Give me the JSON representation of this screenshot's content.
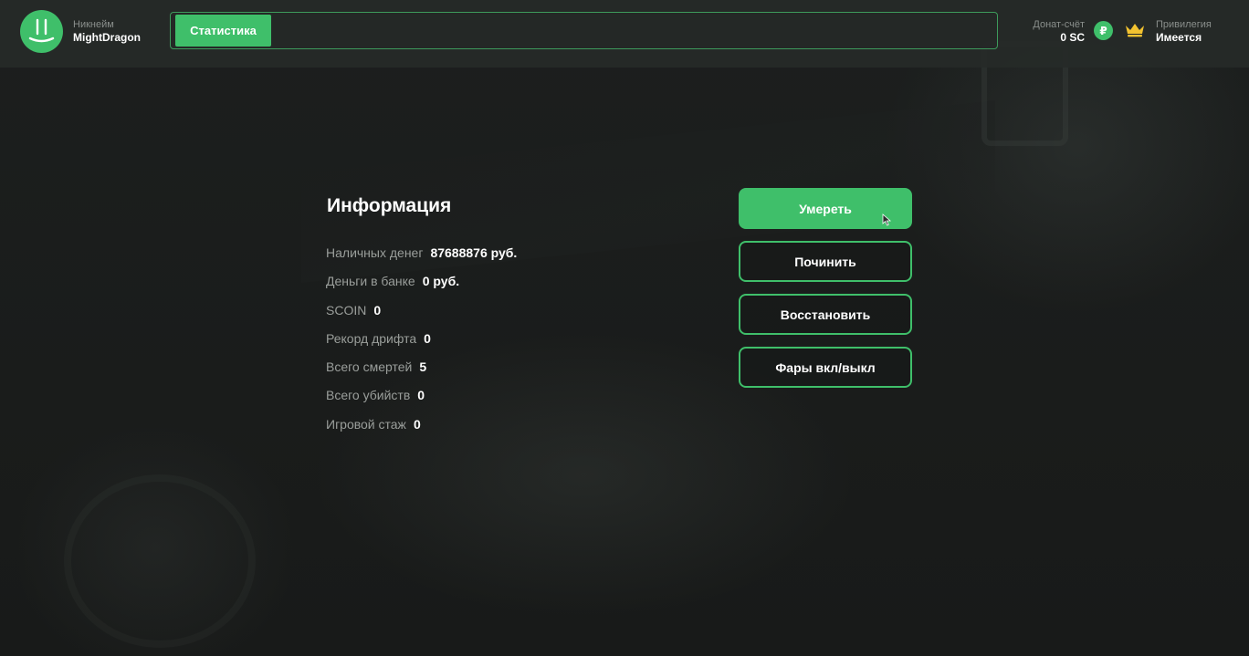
{
  "header": {
    "nickname_caption": "Никнейм",
    "nickname": "MightDragon",
    "tabs": [
      {
        "label": "Статистика",
        "active": true
      }
    ],
    "donate_caption": "Донат-счёт",
    "donate_value": "0 SC",
    "coin_symbol": "₽",
    "privilege_caption": "Привилегия",
    "privilege_value": "Имеется"
  },
  "info": {
    "title": "Информация",
    "rows": [
      {
        "label": "Наличных денег",
        "value": "87688876 руб."
      },
      {
        "label": "Деньги в банке",
        "value": "0 руб."
      },
      {
        "label": "SCOIN",
        "value": "0"
      },
      {
        "label": "Рекорд дрифта",
        "value": "0"
      },
      {
        "label": "Всего смертей",
        "value": "5"
      },
      {
        "label": "Всего убийств",
        "value": "0"
      },
      {
        "label": "Игровой стаж",
        "value": "0"
      }
    ]
  },
  "actions": [
    {
      "label": "Умереть",
      "primary": true
    },
    {
      "label": "Починить",
      "primary": false
    },
    {
      "label": "Восстановить",
      "primary": false
    },
    {
      "label": "Фары вкл/выкл",
      "primary": false
    }
  ],
  "colors": {
    "accent": "#3fbf6a",
    "background": "#1a1c1b",
    "topbar": "#262a28",
    "muted_text": "#9a9e9b",
    "crown": "#f2c230"
  },
  "icons": {
    "avatar": "smiley-logo-icon",
    "coin": "ruble-coin-icon",
    "privilege": "crown-icon",
    "pointer": "mouse-cursor-icon"
  }
}
